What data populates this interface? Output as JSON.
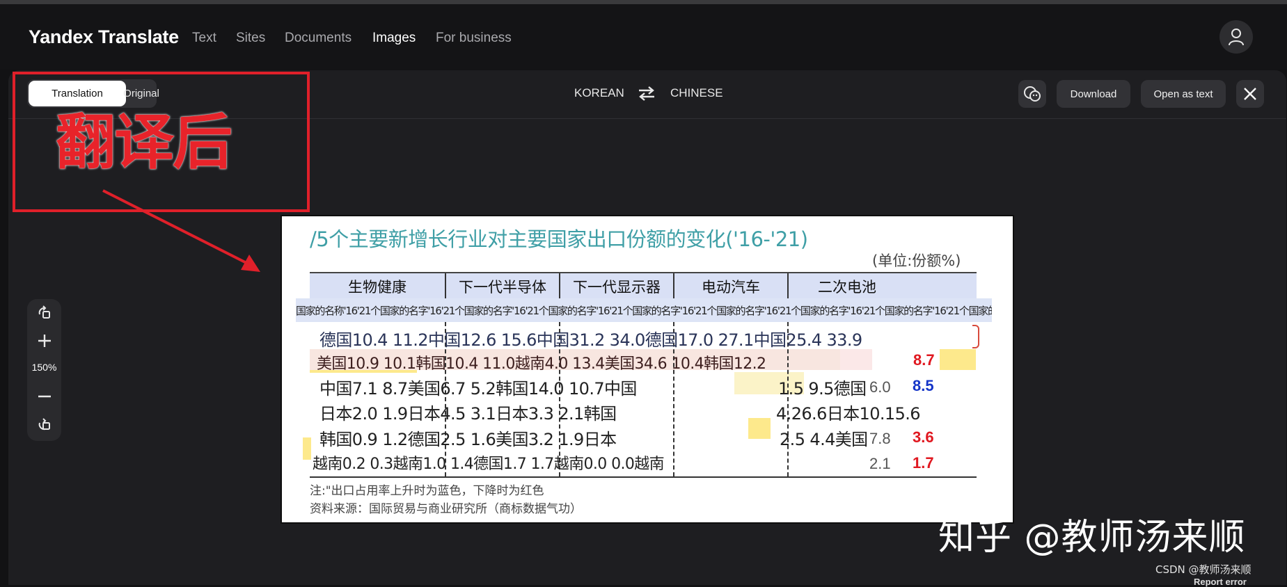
{
  "header": {
    "brand": "Yandex Translate",
    "nav": [
      "Text",
      "Sites",
      "Documents",
      "Images",
      "For business"
    ],
    "active_nav": "Images"
  },
  "toolbar": {
    "tab_translation": "Translation",
    "tab_original": "Original",
    "source_lang": "KOREAN",
    "target_lang": "CHINESE",
    "download_label": "Download",
    "open_as_text_label": "Open as text"
  },
  "zoom": {
    "level": "150%"
  },
  "annotation": {
    "label": "翻译后",
    "color": "#e8232a"
  },
  "document": {
    "title": "/5个主要新增长行业对主要国家出口份额的变化('16-'21)",
    "unit": "(单位:份额%)",
    "columns": [
      "生物健康",
      "下一代半导体",
      "下一代显示器",
      "电动汽车",
      "二次电池"
    ],
    "subheader": "国家的名称'16'21个国家的名字'16'21个国家的名字'16'21个国家的名字'16'21个国家的名字'16'21个国家的名字'16'21个国家的名字'16'21个国家的名字'16'21个国家的名字'16'21个国家的名字'16'21",
    "rows": [
      "德国10.4 11.2中国12.6 15.6中国31.2 34.0德国17.0 27.1中国25.4 33.9",
      "美国10.9 10.1韩国10.4 11.0越南4.0 13.4美国34.6 10.4韩国12.2",
      "中国7.1 8.7美国6.7 5.2韩国14.0 10.7中国",
      "日本2.0 1.9日本4.5 3.1日本3.3 2.1韩国",
      "韩国0.9 1.2德国2.5 1.6美国3.2 1.9日本",
      "越南0.2 0.3越南1.0 1.4德国1.7 1.7越南0.0 0.0越南"
    ],
    "row3_ev": "1.5 9.5德国",
    "row4_ev": "4.26.6日本10.15.6",
    "row5_ev": "2.5 4.4美国",
    "battery_16": [
      "6.0",
      "7.8",
      "2.1"
    ],
    "battery_21": [
      "8.7",
      "8.5",
      "3.6",
      "1.7"
    ],
    "note_1": "注:\"出口占用率上升时为蓝色，下降时为红色",
    "note_2": "资料来源：国际贸易与商业研究所（商标数据气功）"
  },
  "watermark": "知乎 @教师汤来顺",
  "csdn": "CSDN @教师汤来顺",
  "report_error": "Report error",
  "colors": {
    "accent_red": "#e0202a",
    "title_teal": "#3f9fa6",
    "up_blue": "#1535c8",
    "down_red": "#e01820"
  }
}
